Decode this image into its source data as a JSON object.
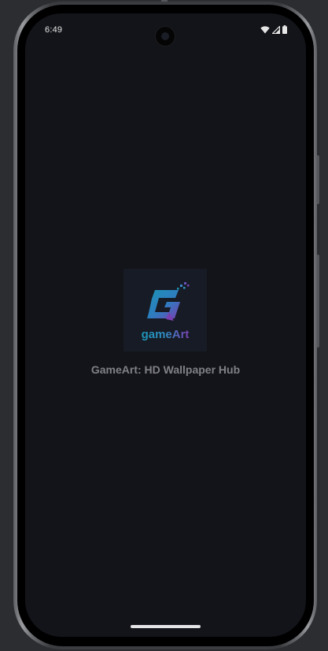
{
  "status_bar": {
    "time": "6:49",
    "icons": [
      "wifi-icon",
      "signal-icon",
      "battery-icon"
    ]
  },
  "splash": {
    "logo_text": "gameArt",
    "logo_letter": "G",
    "app_name": "GameArt: HD Wallpaper Hub"
  },
  "colors": {
    "screen_background": "#131419",
    "logo_background": "#171b25",
    "logo_teal": "#1c93b4",
    "logo_purple": "#7a3fb0",
    "app_name_text": "#808187"
  }
}
